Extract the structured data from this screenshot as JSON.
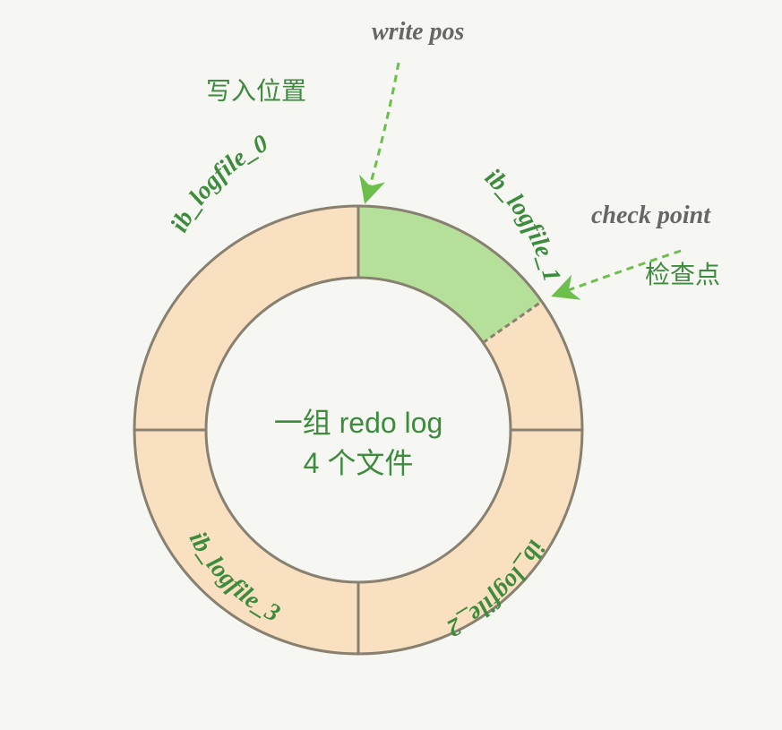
{
  "labels": {
    "write_pos_hand": "write pos",
    "write_pos_cn": "写入位置",
    "check_point_hand": "check point",
    "check_point_cn": "检查点",
    "center_line1": "一组 redo log",
    "center_line2": "4 个文件"
  },
  "segments": {
    "file0": "ib_logfile_0",
    "file1": "ib_logfile_1",
    "file2": "ib_logfile_2",
    "file3": "ib_logfile_3"
  },
  "colors": {
    "ring_fill": "#f8e0c0",
    "ring_stroke": "#888070",
    "highlight_fill": "#b5e09a",
    "text_green": "#3d8b3d",
    "text_hand": "#666",
    "arrow_green": "#6bbf4a"
  },
  "chart_data": {
    "type": "pie",
    "title": "一组 redo log 4 个文件",
    "categories": [
      "ib_logfile_0",
      "ib_logfile_1",
      "ib_logfile_2",
      "ib_logfile_3"
    ],
    "values": [
      90,
      90,
      90,
      90
    ],
    "annotations": [
      {
        "name": "write pos",
        "angle_deg": 90,
        "label_cn": "写入位置"
      },
      {
        "name": "check point",
        "angle_deg": 35,
        "label_cn": "检查点"
      }
    ],
    "highlight_range_deg": [
      35,
      90
    ],
    "note": "Ring buffer of 4 redo log files; shaded wedge is between write pos and check point"
  }
}
